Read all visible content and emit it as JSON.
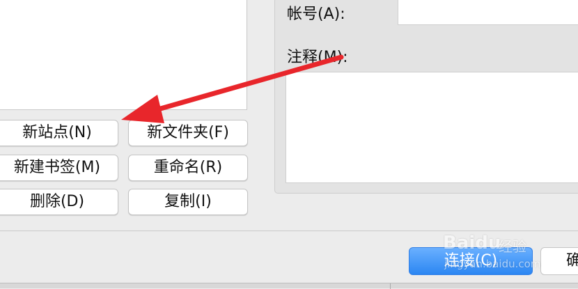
{
  "site_manager": {
    "buttons": {
      "new_site": "新站点(N)",
      "new_folder": "新文件夹(F)",
      "new_bookmark": "新建书签(M)",
      "rename": "重命名(R)",
      "delete": "删除(D)",
      "copy": "复制(I)"
    }
  },
  "details": {
    "account_label": "帐号(A):",
    "account_value": "",
    "comment_label": "注释(M):",
    "comment_value": ""
  },
  "footer": {
    "connect_label": "连接(C)",
    "ok_label": "确"
  },
  "annotation": {
    "arrow_color": "#e8262b"
  },
  "watermark": {
    "brand": "Baidu",
    "sub": "经验",
    "url": "jingyan.baidu.com"
  },
  "colors": {
    "primary_button": "#2b86f2",
    "panel_bg": "#e3e3e3",
    "window_bg": "#ececec"
  }
}
